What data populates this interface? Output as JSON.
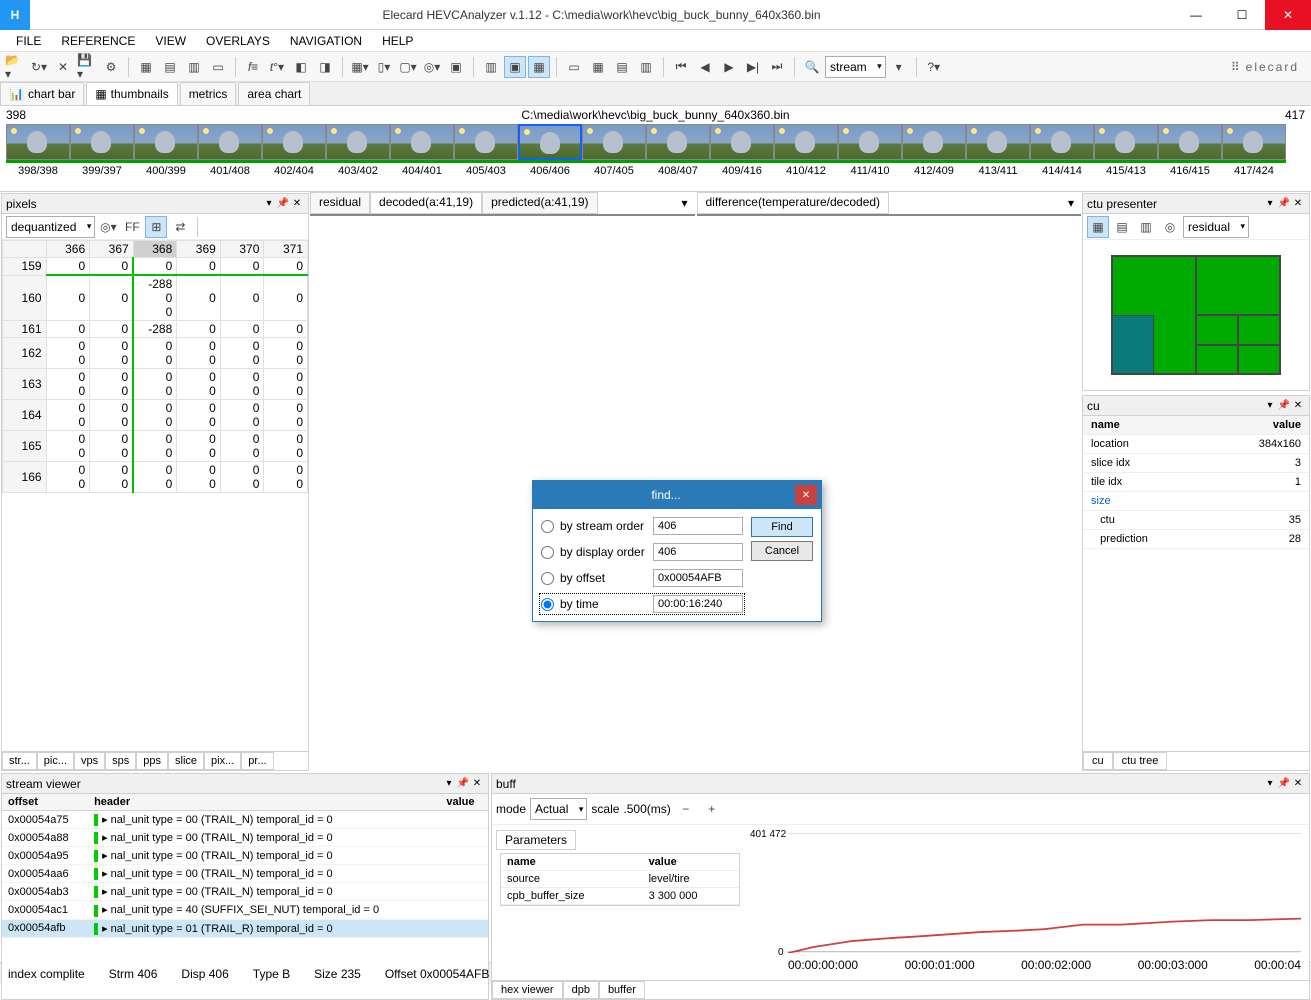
{
  "window": {
    "title": "Elecard HEVCAnalyzer v.1.12 - C:\\media\\work\\hevc\\big_buck_bunny_640x360.bin",
    "app_icon_letter": "H"
  },
  "menu": [
    "FILE",
    "REFERENCE",
    "VIEW",
    "OVERLAYS",
    "NAVIGATION",
    "HELP"
  ],
  "toolbar": {
    "stream_label": "stream"
  },
  "brand": "elecard",
  "view_tabs": [
    {
      "icon": "chart",
      "label": "chart bar"
    },
    {
      "icon": "thumb",
      "label": "thumbnails",
      "active": true
    },
    {
      "icon": "",
      "label": "metrics"
    },
    {
      "icon": "",
      "label": "area chart"
    }
  ],
  "thumb_strip": {
    "left_num": "398",
    "path": "C:\\media\\work\\hevc\\big_buck_bunny_640x360.bin",
    "right_num": "417",
    "thumbs": [
      {
        "label": "398/398"
      },
      {
        "label": "399/397"
      },
      {
        "label": "400/399"
      },
      {
        "label": "401/408"
      },
      {
        "label": "402/404"
      },
      {
        "label": "403/402"
      },
      {
        "label": "404/401"
      },
      {
        "label": "405/403"
      },
      {
        "label": "406/406",
        "selected": true
      },
      {
        "label": "407/405"
      },
      {
        "label": "408/407"
      },
      {
        "label": "409/416"
      },
      {
        "label": "410/412"
      },
      {
        "label": "411/410"
      },
      {
        "label": "412/409"
      },
      {
        "label": "413/411"
      },
      {
        "label": "414/414"
      },
      {
        "label": "415/413"
      },
      {
        "label": "416/415"
      },
      {
        "label": "417/424"
      }
    ]
  },
  "pixels_panel": {
    "title": "pixels",
    "dropdown": "dequantized",
    "ff_label": "FF",
    "cols": [
      "366",
      "367",
      "368",
      "369",
      "370",
      "371"
    ],
    "selected_col": "368",
    "rows": [
      {
        "h": "159",
        "c": [
          "0",
          "0",
          "0",
          "0",
          "0",
          "0"
        ]
      },
      {
        "h": "160",
        "c": [
          "0",
          "0",
          "-288\n0\n0",
          "0",
          "0",
          "0"
        ],
        "greentop": true
      },
      {
        "h": "161",
        "c": [
          "0",
          "0",
          "-288",
          "0",
          "0",
          "0"
        ]
      },
      {
        "h": "162",
        "c": [
          "0\n0",
          "0\n0",
          "0\n0",
          "0\n0",
          "0\n0",
          "0\n0"
        ]
      },
      {
        "h": "163",
        "c": [
          "0\n0",
          "0\n0",
          "0\n0",
          "0\n0",
          "0\n0",
          "0\n0"
        ]
      },
      {
        "h": "164",
        "c": [
          "0\n0",
          "0\n0",
          "0\n0",
          "0\n0",
          "0\n0",
          "0\n0"
        ]
      },
      {
        "h": "165",
        "c": [
          "0\n0",
          "0\n0",
          "0\n0",
          "0\n0",
          "0\n0",
          "0\n0"
        ]
      },
      {
        "h": "166",
        "c": [
          "0\n0",
          "0\n0",
          "0\n0",
          "0\n0",
          "0\n0",
          "0\n0"
        ]
      }
    ],
    "bottom_tabs": [
      "str...",
      "pic...",
      "vps",
      "sps",
      "pps",
      "slice",
      "pix...",
      "pr..."
    ],
    "active_bottom": "pix..."
  },
  "center_tabs": {
    "left": [
      "residual",
      "decoded(a:41,19)",
      "predicted(a:41,19)"
    ],
    "left_active": "decoded(a:41,19)",
    "right": "difference(temperature/decoded)"
  },
  "ctu_presenter": {
    "title": "ctu presenter",
    "dropdown": "residual"
  },
  "cu_panel": {
    "title": "cu",
    "headers": [
      "name",
      "value"
    ],
    "rows": [
      {
        "name": "location",
        "value": "384x160"
      },
      {
        "name": "slice idx",
        "value": "3"
      },
      {
        "name": "tile idx",
        "value": "1"
      },
      {
        "name": "size",
        "value": "",
        "link": true
      },
      {
        "name": "   ctu",
        "value": "35"
      },
      {
        "name": "   prediction",
        "value": "28"
      }
    ],
    "bottom_tabs": [
      "cu",
      "ctu tree"
    ],
    "active": "cu"
  },
  "stream_viewer": {
    "title": "stream viewer",
    "headers": [
      "offset",
      "header",
      "value"
    ],
    "rows": [
      {
        "offset": "0x00054a75",
        "header": "nal_unit type = 00 (TRAIL_N) temporal_id = 0"
      },
      {
        "offset": "0x00054a88",
        "header": "nal_unit type = 00 (TRAIL_N) temporal_id = 0"
      },
      {
        "offset": "0x00054a95",
        "header": "nal_unit type = 00 (TRAIL_N) temporal_id = 0"
      },
      {
        "offset": "0x00054aa6",
        "header": "nal_unit type = 00 (TRAIL_N) temporal_id = 0"
      },
      {
        "offset": "0x00054ab3",
        "header": "nal_unit type = 00 (TRAIL_N) temporal_id = 0"
      },
      {
        "offset": "0x00054ac1",
        "header": "nal_unit type = 40 (SUFFIX_SEI_NUT) temporal_id = 0"
      },
      {
        "offset": "0x00054afb",
        "header": "nal_unit type = 01 (TRAIL_R) temporal_id = 0",
        "sel": true
      }
    ]
  },
  "buffer": {
    "title": "buff",
    "mode_label": "mode",
    "mode_value": "Actual",
    "scale_label": "scale",
    "scale_value": ".500(ms)",
    "param_tab": "Parameters",
    "param_headers": [
      "name",
      "value"
    ],
    "params": [
      {
        "name": "source",
        "value": "level/tire"
      },
      {
        "name": "cpb_buffer_size",
        "value": "3 300 000"
      }
    ],
    "bottom_tabs": [
      "hex viewer",
      "dpb",
      "buffer"
    ],
    "active": "buffer"
  },
  "chart_data": {
    "type": "line",
    "title": "",
    "xlabel": "time",
    "ylabel": "buffer",
    "ylim": [
      0,
      401472
    ],
    "y_tick_top": "401 472",
    "y_tick_bottom": "0",
    "x_ticks": [
      "00:00:00:000",
      "00:00:01:000",
      "00:00:02:000",
      "00:00:03:000",
      "00:00:04"
    ],
    "series": [
      {
        "name": "buffer",
        "color": "#d04040",
        "x": [
          0,
          0.2,
          0.5,
          0.8,
          1.0,
          1.5,
          1.8,
          2.0,
          2.3,
          2.6,
          3.0,
          3.3,
          3.6,
          4.0
        ],
        "values": [
          0,
          20000,
          40000,
          50000,
          55000,
          70000,
          75000,
          80000,
          95000,
          95000,
          105000,
          110000,
          110000,
          115000
        ]
      }
    ]
  },
  "find": {
    "title": "find...",
    "opt_stream": "by stream order",
    "opt_stream_val": "406",
    "opt_display": "by display order",
    "opt_display_val": "406",
    "opt_offset": "by offset",
    "opt_offset_val": "0x00054AFB",
    "opt_time": "by time",
    "opt_time_val": "00:00:16:240",
    "btn_find": "Find",
    "btn_cancel": "Cancel"
  },
  "status": {
    "msg": "index complite",
    "strm": "Strm 406",
    "disp": "Disp 406",
    "type": "Type B",
    "size": "Size 235",
    "offset": "Offset 0x00054AFB"
  }
}
